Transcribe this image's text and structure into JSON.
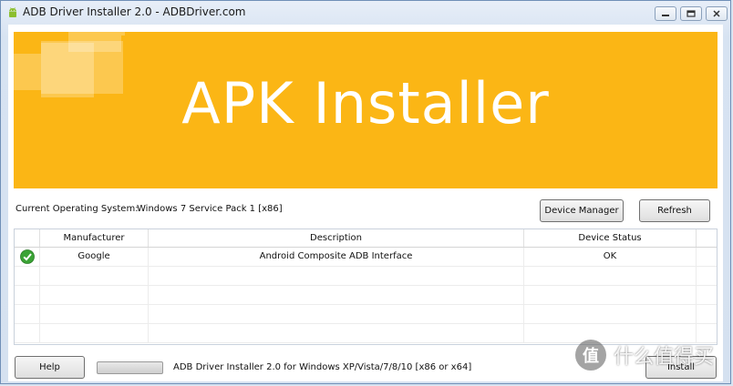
{
  "window": {
    "title": "ADB Driver Installer 2.0 - ADBDriver.com",
    "controls": [
      "minimize",
      "maximize",
      "close"
    ]
  },
  "banner": {
    "title": "APK Installer",
    "color": "#fbb615"
  },
  "system": {
    "label": "Current Operating System:",
    "value": "Windows 7 Service Pack 1 [x86]"
  },
  "buttons": {
    "device_manager": "Device Manager",
    "refresh": "Refresh",
    "help": "Help",
    "install": "Install"
  },
  "table": {
    "columns": [
      "",
      "Manufacturer",
      "Description",
      "Device Status"
    ],
    "rows": [
      {
        "status_icon": "check-icon",
        "manufacturer": "Google",
        "description": "Android Composite ADB Interface",
        "device_status": "OK"
      }
    ]
  },
  "footer": {
    "status_text": "ADB Driver Installer 2.0 for Windows XP/Vista/7/8/10 [x86 or x64]"
  },
  "watermark": {
    "logo": "值",
    "text": "什么值得买"
  }
}
